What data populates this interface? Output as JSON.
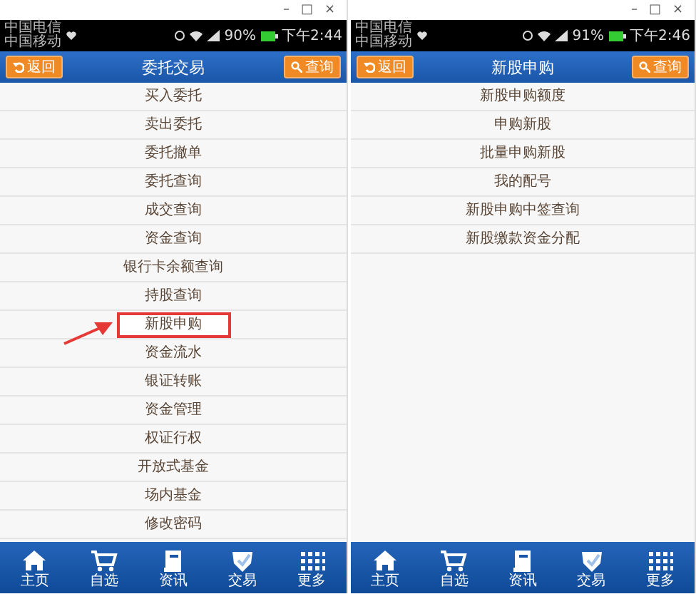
{
  "panels": [
    {
      "window_controls": [
        "–",
        "□",
        "×"
      ],
      "status_bar": {
        "carriers": [
          "中国电信",
          "中国移动"
        ],
        "battery": "90%",
        "time": "下午2:44"
      },
      "header": {
        "back": "返回",
        "title": "委托交易",
        "search": "查询"
      },
      "menu": [
        {
          "label": "买入委托",
          "highlighted": false
        },
        {
          "label": "卖出委托",
          "highlighted": false
        },
        {
          "label": "委托撤单",
          "highlighted": false
        },
        {
          "label": "委托查询",
          "highlighted": false
        },
        {
          "label": "成交查询",
          "highlighted": false
        },
        {
          "label": "资金查询",
          "highlighted": false
        },
        {
          "label": "银行卡余额查询",
          "highlighted": false
        },
        {
          "label": "持股查询",
          "highlighted": false
        },
        {
          "label": "新股申购",
          "highlighted": true
        },
        {
          "label": "资金流水",
          "highlighted": false
        },
        {
          "label": "银证转账",
          "highlighted": false
        },
        {
          "label": "资金管理",
          "highlighted": false
        },
        {
          "label": "权证行权",
          "highlighted": false
        },
        {
          "label": "开放式基金",
          "highlighted": false
        },
        {
          "label": "场内基金",
          "highlighted": false
        },
        {
          "label": "修改密码",
          "highlighted": false
        }
      ],
      "nav": [
        {
          "label": "主页",
          "kind": "home"
        },
        {
          "label": "自选",
          "kind": "cart"
        },
        {
          "label": "资讯",
          "kind": "news"
        },
        {
          "label": "交易",
          "kind": "shield"
        },
        {
          "label": "更多",
          "kind": "grid"
        }
      ]
    },
    {
      "window_controls": [
        "–",
        "□",
        "×"
      ],
      "status_bar": {
        "carriers": [
          "中国电信",
          "中国移动"
        ],
        "battery": "91%",
        "time": "下午2:46"
      },
      "header": {
        "back": "返回",
        "title": "新股申购",
        "search": "查询"
      },
      "menu": [
        {
          "label": "新股申购额度",
          "highlighted": false
        },
        {
          "label": "申购新股",
          "highlighted": false
        },
        {
          "label": "批量申购新股",
          "highlighted": false
        },
        {
          "label": "我的配号",
          "highlighted": false
        },
        {
          "label": "新股申购中签查询",
          "highlighted": false
        },
        {
          "label": "新股缴款资金分配",
          "highlighted": false
        }
      ],
      "nav": [
        {
          "label": "主页",
          "kind": "home"
        },
        {
          "label": "自选",
          "kind": "cart"
        },
        {
          "label": "资讯",
          "kind": "news"
        },
        {
          "label": "交易",
          "kind": "shield"
        },
        {
          "label": "更多",
          "kind": "grid"
        }
      ]
    }
  ]
}
